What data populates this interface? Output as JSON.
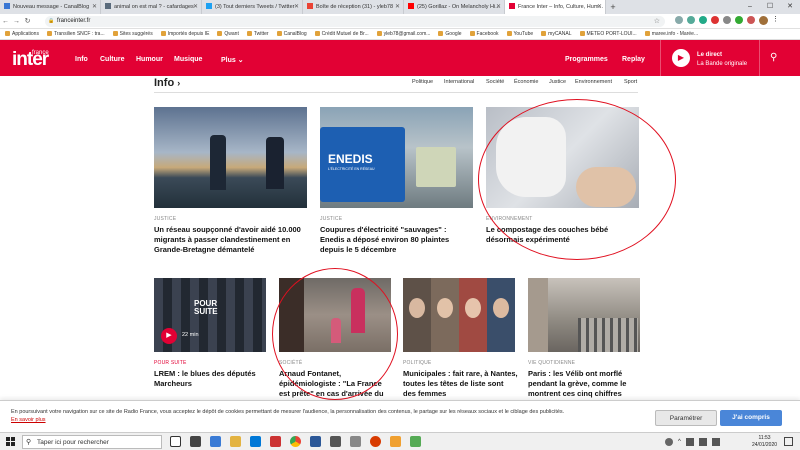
{
  "browser": {
    "tabs": [
      {
        "title": "Nouveau message - CanalBlog",
        "color": "#3a77d4"
      },
      {
        "title": "animal on est mal ? - cafardages",
        "color": "#5a6b7c"
      },
      {
        "title": "(3) Tout derniers Tweets / Twitter",
        "color": "#1da1f2"
      },
      {
        "title": "Boîte de réception (31) - yleb78",
        "color": "#ea4335"
      },
      {
        "title": "(25) Gorillaz - On Melancholy Hi...",
        "color": "#ff0000"
      },
      {
        "title": "France Inter – Info, Culture, Hum...",
        "color": "#e20134"
      }
    ],
    "url": "franceinter.fr",
    "bookmarks": [
      "Applications",
      "Transilien SNCF : tra...",
      "Sites suggérés",
      "Importés depuis IE",
      "Qwant",
      "Twitter",
      "CanalBlog",
      "Crédit Mutuel de Br...",
      "yleb78@gmail.com...",
      "Google",
      "Facebook",
      "YouTube",
      "myCANAL",
      "METEO PORT-LOUI...",
      "maree.info - Marée..."
    ]
  },
  "header": {
    "logo": "inter",
    "logo_small": "france",
    "nav": [
      "Info",
      "Culture",
      "Humour",
      "Musique",
      "Plus"
    ],
    "right_nav": [
      "Programmes",
      "Replay"
    ],
    "direct_line1": "Le direct",
    "direct_line2": "La Bande originale"
  },
  "section": {
    "title": "Info",
    "subnav": [
      "Politique",
      "International",
      "Société",
      "Économie",
      "Justice",
      "Environnement",
      "Sport"
    ]
  },
  "articles_row1": [
    {
      "category": "JUSTICE",
      "title": "Un réseau soupçonné d'avoir aidé 10.000 migrants à passer clandestinement en Grande-Bretagne démantelé"
    },
    {
      "category": "JUSTICE",
      "title": "Coupures d'électricité \"sauvages\" : Enedis a déposé environ 80 plaintes depuis le 5 décembre",
      "image_text": "ENEDIS",
      "image_subtext": "L'ÉLECTRICITÉ EN RÉSEAU"
    },
    {
      "category": "ENVIRONNEMENT",
      "title": "Le compostage des couches bébé désormais expérimenté"
    }
  ],
  "articles_row2": [
    {
      "category": "POUR SUITE",
      "title": "LREM : le blues des députés Marcheurs",
      "duration": "22 min",
      "image_text": "POUR SUITE"
    },
    {
      "category": "SOCIÉTÉ",
      "title": "Arnaud Fontanet, épidémiologiste : \"La France est prête\" en cas d'arrivée du coronavirus"
    },
    {
      "category": "POLITIQUE",
      "title": "Municipales : fait rare, à Nantes, toutes les têtes de liste sont des femmes"
    },
    {
      "category": "VIE QUOTIDIENNE",
      "title": "Paris : les Vélib ont morflé pendant la grève, comme le montrent ces cinq chiffres"
    }
  ],
  "cookie": {
    "text": "En poursuivant votre navigation sur ce site de Radio France, vous acceptez le dépôt de cookies permettant de mesurer l'audience, la personnalisation des contenus, le partage sur les réseaux sociaux et le ciblage des publicités.",
    "link": "En savoir plus",
    "settings": "Paramétrer",
    "accept": "J'ai compris"
  },
  "taskbar": {
    "search_placeholder": "Taper ici pour rechercher",
    "time": "11:53",
    "date": "24/01/2020"
  }
}
